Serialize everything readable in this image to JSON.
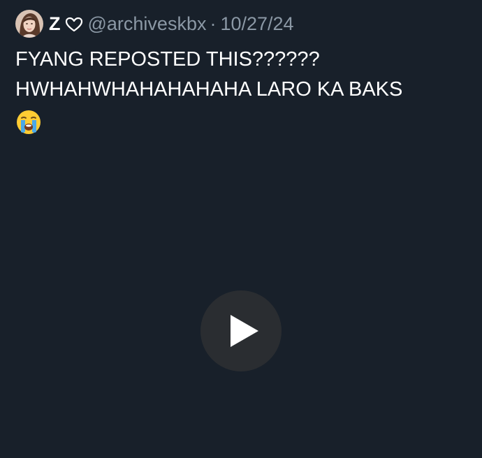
{
  "author": {
    "display_name": "Z",
    "name_icon": "heart-outline-icon",
    "handle": "@archiveskbx",
    "separator": "·",
    "date": "10/27/24"
  },
  "post": {
    "line1": "FYANG REPOSTED THIS??????",
    "line2": "HWHAHWHAHAHAHAHA LARO KA BAKS",
    "emoji": "loudly-crying-face-icon"
  },
  "media": {
    "play_icon": "play-icon"
  },
  "colors": {
    "background": "#18202a",
    "text_primary": "#ffffff",
    "text_secondary": "#8b98a5",
    "play_button": "#2a2d31"
  }
}
